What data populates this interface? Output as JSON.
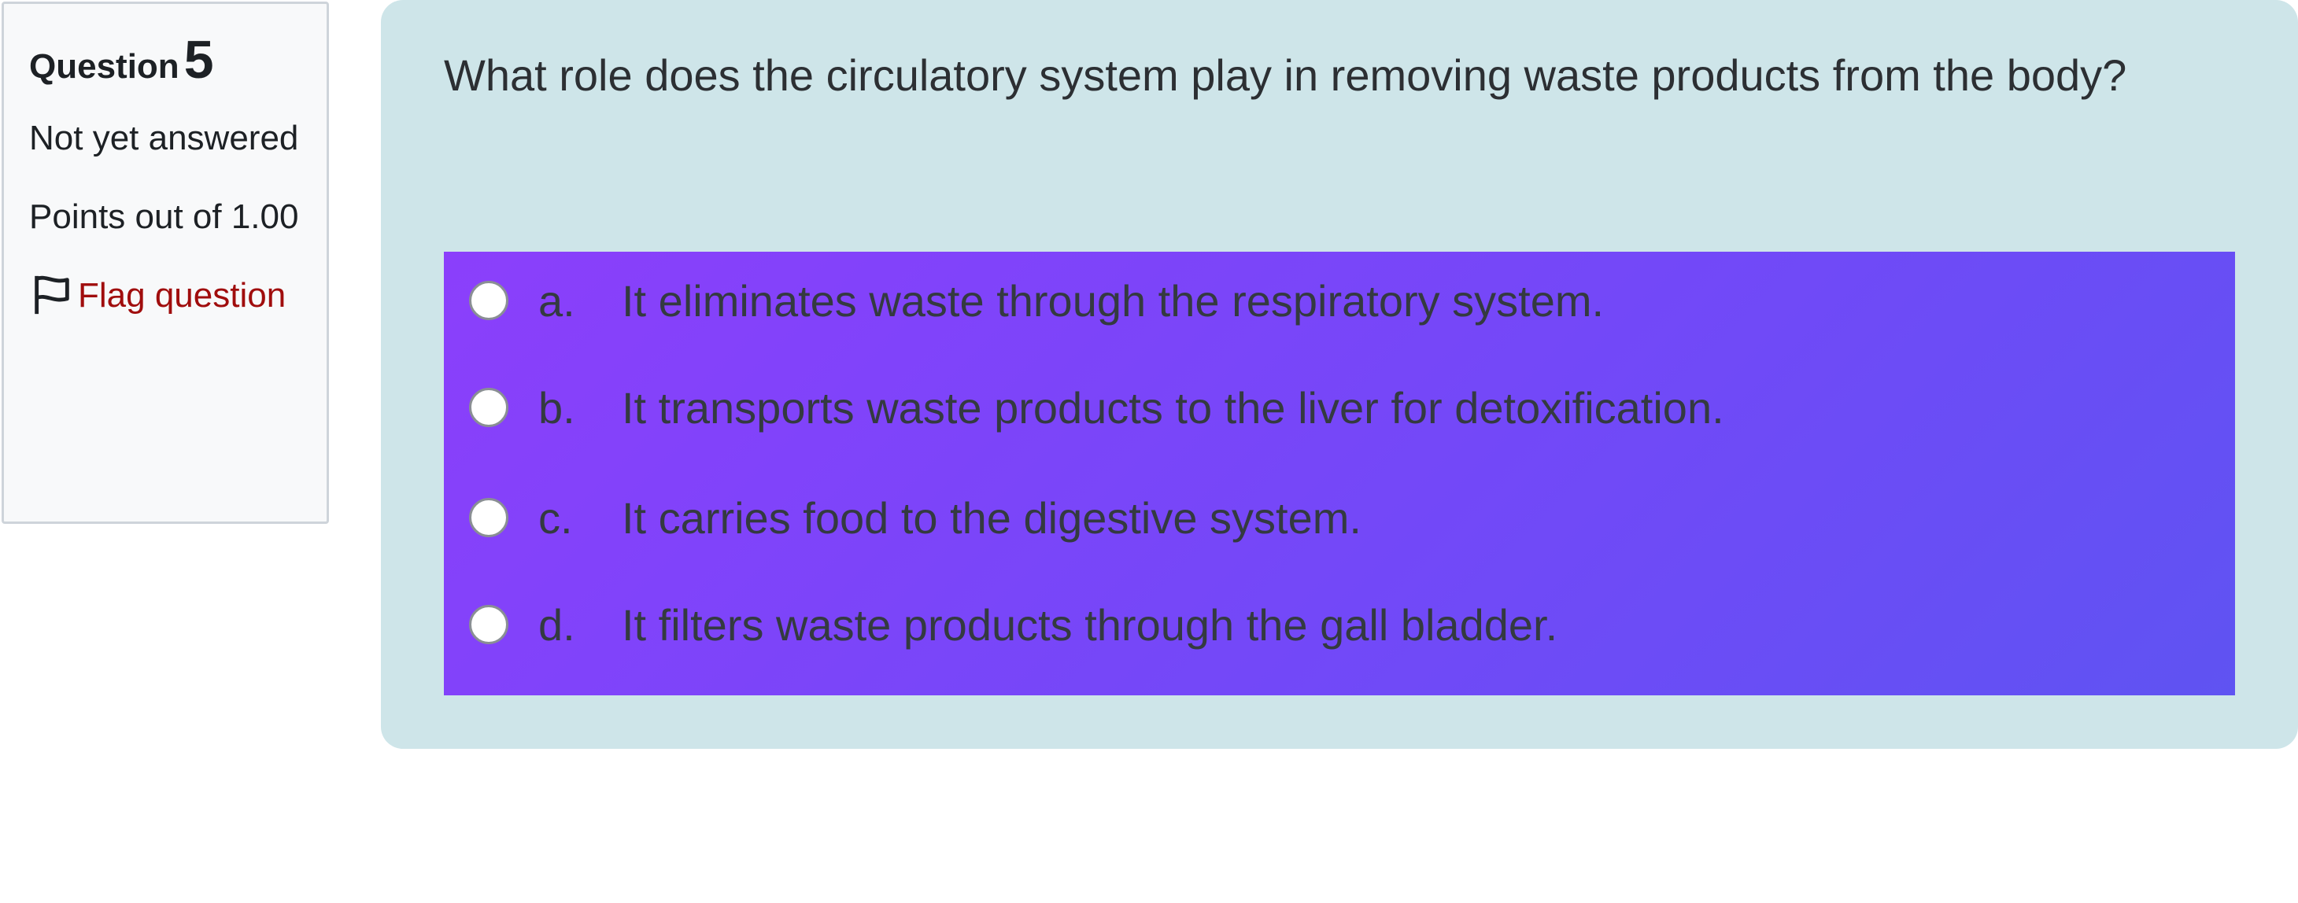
{
  "info": {
    "question_label": "Question",
    "question_number": "5",
    "state": "Not yet answered",
    "grade": "Points out of 1.00",
    "flag_label": "Flag question"
  },
  "question": {
    "text": "What role does the circulatory system play in removing waste products from the body?",
    "options": [
      {
        "letter": "a.",
        "text": "It eliminates waste through the respiratory system."
      },
      {
        "letter": "b.",
        "text": "It transports waste products to the liver for detoxification."
      },
      {
        "letter": "c.",
        "text": "It carries food to the digestive system."
      },
      {
        "letter": "d.",
        "text": "It filters waste products through the gall bladder."
      }
    ]
  },
  "colors": {
    "panel_bg": "#cee5e9",
    "answers_gradient_start": "#8b3ffb",
    "answers_gradient_end": "#5f53f2",
    "flag_link": "#a00d0d"
  },
  "icons": {
    "flag": "flag-icon",
    "radio": "radio-button"
  }
}
